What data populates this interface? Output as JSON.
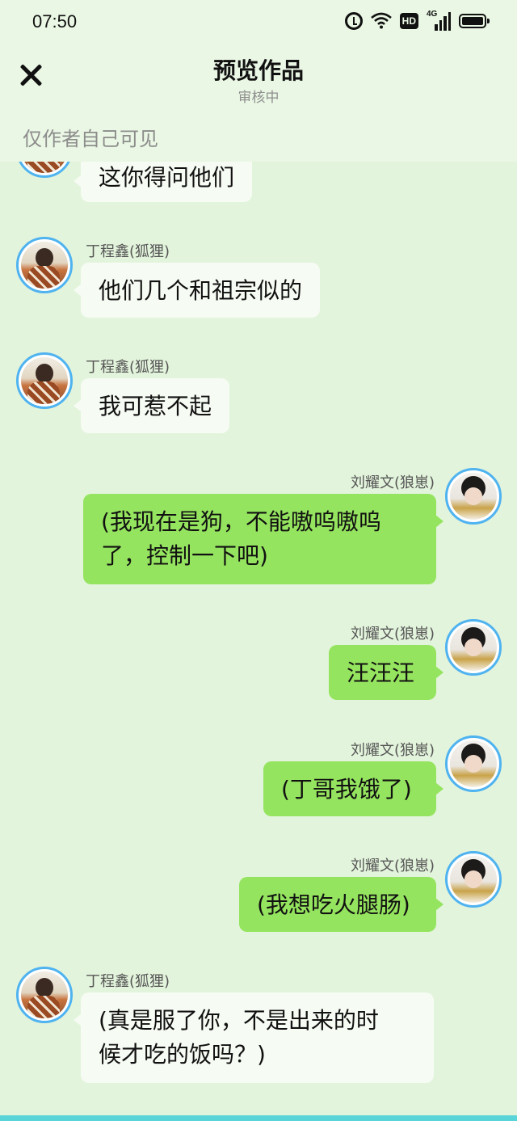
{
  "status_bar": {
    "time": "07:50",
    "icons": [
      "alarm-icon",
      "wifi-icon",
      "hd-icon",
      "signal-4g-icon",
      "battery-icon"
    ],
    "network_label": "4G",
    "hd_label": "HD"
  },
  "header": {
    "title": "预览作品",
    "subtitle": "审核中",
    "visibility_note": "仅作者自己可见"
  },
  "colors": {
    "background": "#e3f4dc",
    "right_bubble": "#95e45f",
    "left_bubble": "#f6fbf3",
    "avatar_ring": "#4fb3f0"
  },
  "messages": [
    {
      "side": "left",
      "name": "",
      "text": "这你得问他们"
    },
    {
      "side": "left",
      "name": "丁程鑫(狐狸)",
      "text": "他们几个和祖宗似的"
    },
    {
      "side": "left",
      "name": "丁程鑫(狐狸)",
      "text": "我可惹不起"
    },
    {
      "side": "right",
      "name": "刘耀文(狼崽)",
      "text_lines": [
        "(我现在是狗，不能嗷呜嗷呜",
        "了，控制一下吧)"
      ]
    },
    {
      "side": "right",
      "name": "刘耀文(狼崽)",
      "text": "汪汪汪"
    },
    {
      "side": "right",
      "name": "刘耀文(狼崽)",
      "text": "(丁哥我饿了)"
    },
    {
      "side": "right",
      "name": "刘耀文(狼崽)",
      "text": "(我想吃火腿肠)"
    },
    {
      "side": "left",
      "name": "丁程鑫(狐狸)",
      "text_lines": [
        "(真是服了你，不是出来的时",
        "候才吃的饭吗？)"
      ]
    }
  ]
}
